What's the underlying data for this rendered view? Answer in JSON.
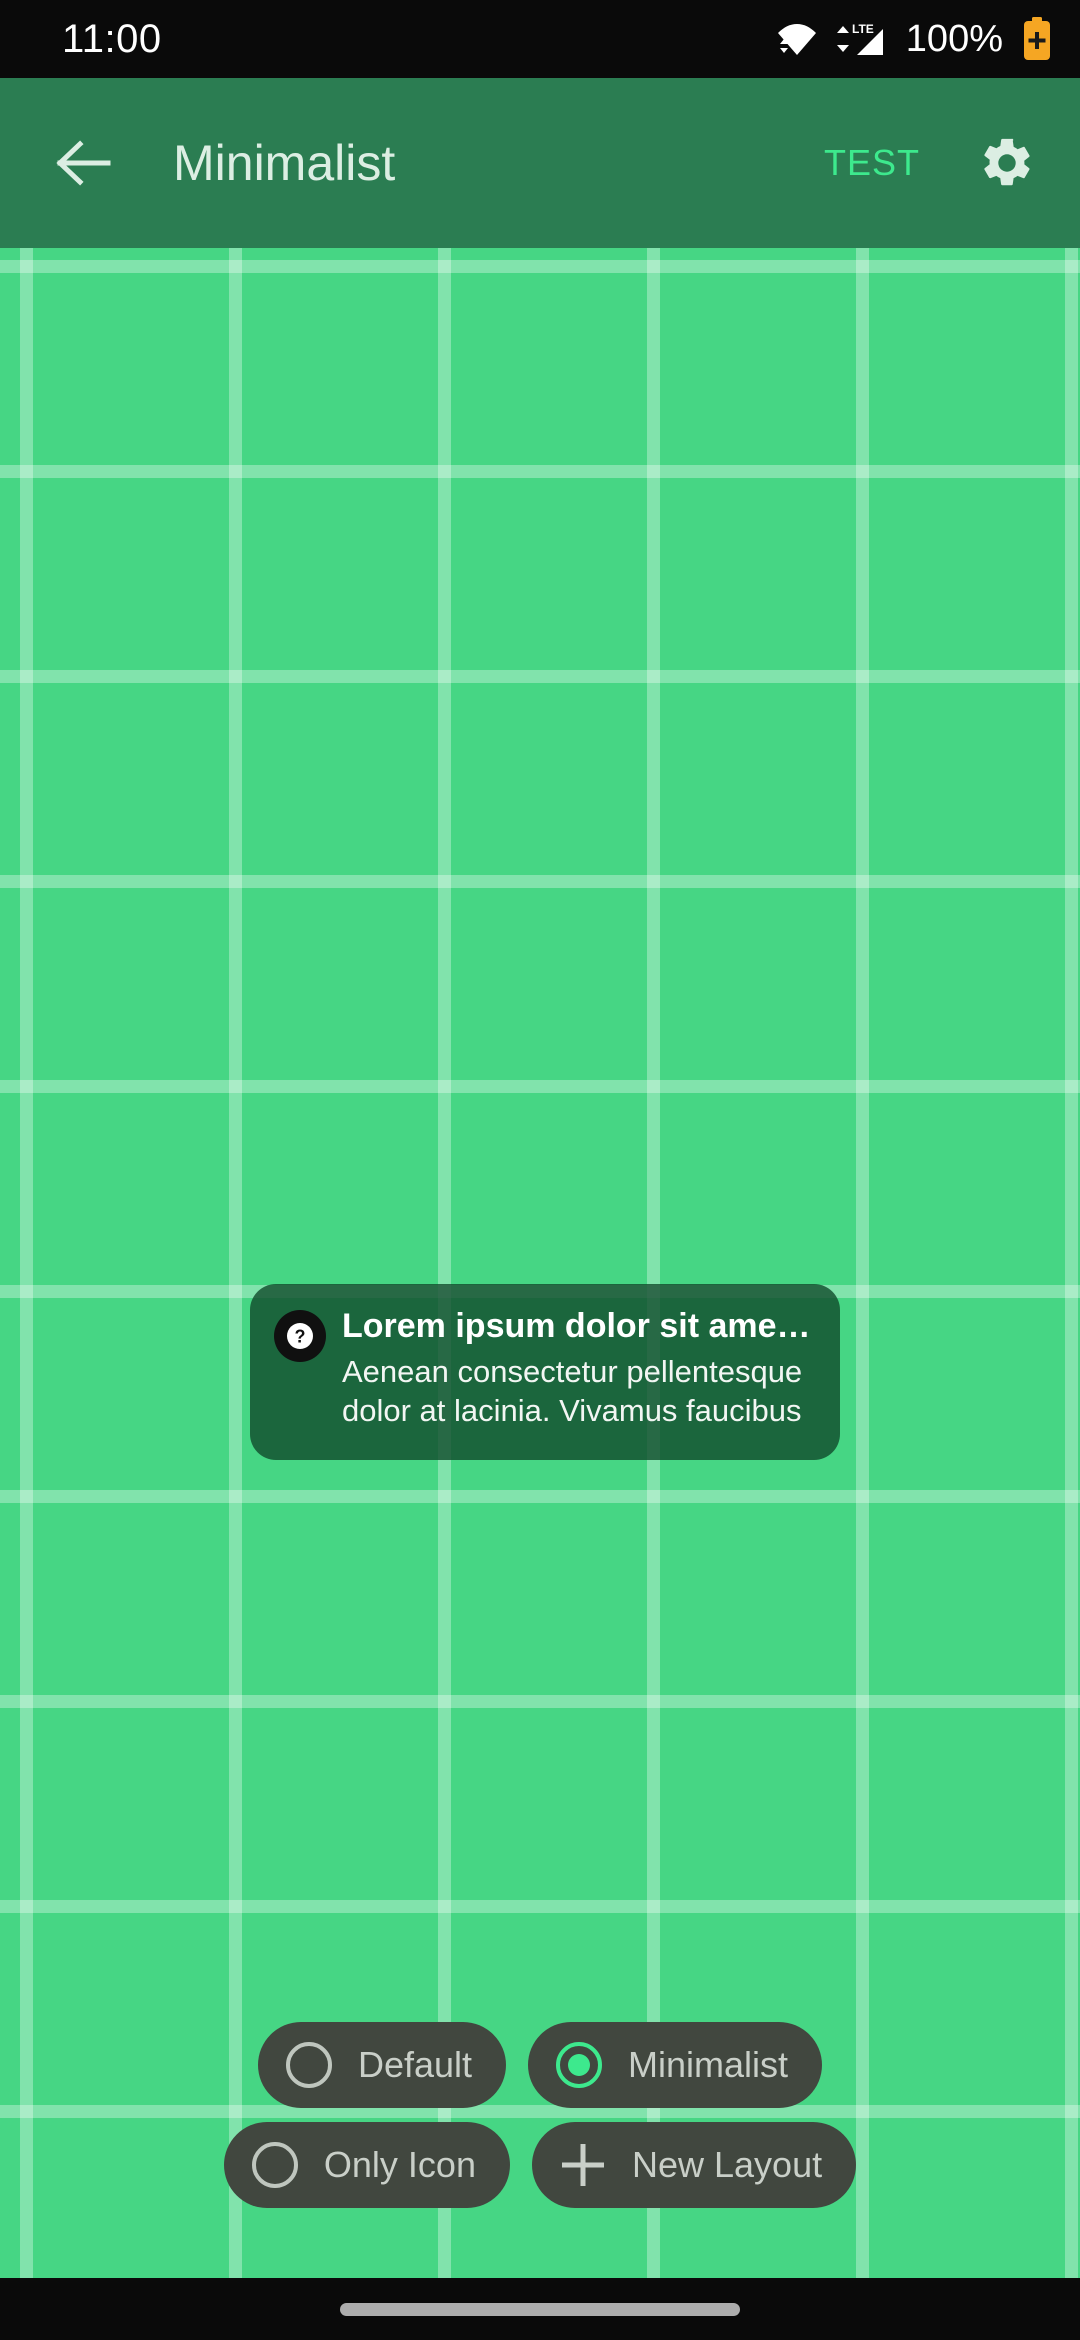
{
  "status_bar": {
    "time": "11:00",
    "battery_percent": "100%",
    "icons": [
      "wifi-icon",
      "lte-signal-icon",
      "battery-saver-icon"
    ],
    "network_label": "LTE",
    "background": "#0A0A0A",
    "battery_color": "#F5A623"
  },
  "app_bar": {
    "back_label": "back-arrow-icon",
    "title": "Minimalist",
    "action_label": "TEST",
    "settings_label": "gear-icon",
    "background": "#2B7D52",
    "title_color": "#DCEEE3",
    "action_color": "#3DE98D"
  },
  "canvas": {
    "background": "#46D684",
    "grid_line_color": "rgba(255,255,255,0.32)",
    "grid_cell_width": 209,
    "grid_cell_height": 205
  },
  "tooltip": {
    "icon": "help-circle-icon",
    "title": "Lorem ipsum dolor sit amet dolo…",
    "body": "Aenean consectetur pellentesque dolor at lacinia. Vivamus faucibus libero id …",
    "background": "rgba(16,74,44,0.80)",
    "title_color": "#FFFFFF",
    "body_color": "#F2F6F3"
  },
  "layout_chips": {
    "chip_background": "#41473F",
    "label_color": "#C9CFC8",
    "selected_color": "#3DE98D",
    "unselected_color": "#BFC6BE",
    "rows": [
      [
        {
          "label": "Default",
          "icon": "radio-unselected-icon",
          "selected": false
        },
        {
          "label": "Minimalist",
          "icon": "radio-selected-icon",
          "selected": true
        }
      ],
      [
        {
          "label": "Only Icon",
          "icon": "radio-unselected-icon",
          "selected": false
        },
        {
          "label": "New Layout",
          "icon": "plus-icon",
          "selected": false
        }
      ]
    ]
  },
  "nav_bar": {
    "gesture_pill": "gesture-handle",
    "background": "#0A0A0A",
    "pill_color": "#ADADAD"
  }
}
